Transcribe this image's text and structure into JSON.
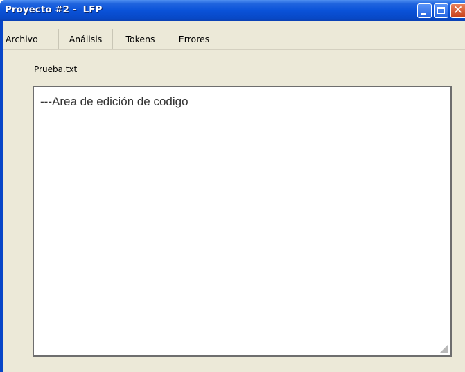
{
  "window": {
    "title": "Proyecto #2 -  LFP"
  },
  "menu": {
    "items": [
      {
        "label": "Archivo"
      },
      {
        "label": "Análisis"
      },
      {
        "label": "Tokens"
      },
      {
        "label": "Errores"
      }
    ]
  },
  "file": {
    "name": "Prueba.txt"
  },
  "editor": {
    "content": "---Area de edición de codigo"
  },
  "colors": {
    "titlebar": "#0a52d8",
    "window_body": "#ece9d8",
    "editor_bg": "#ffffff"
  }
}
